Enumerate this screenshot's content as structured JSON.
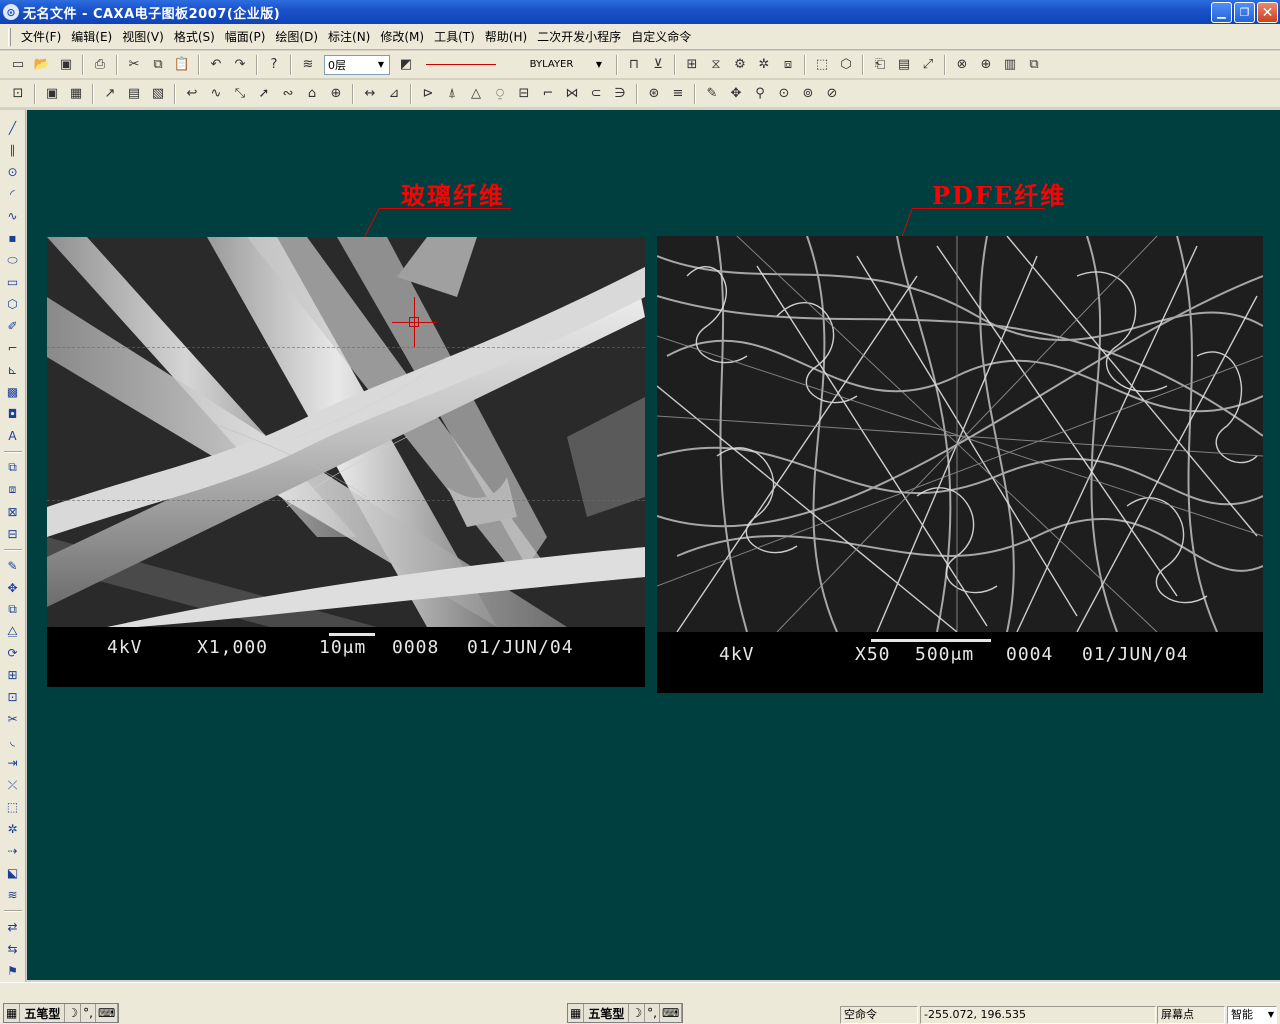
{
  "window": {
    "title": "无名文件 - CAXA电子图板2007(企业版)",
    "minimize_glyph": "▁",
    "restore_glyph": "❐",
    "close_glyph": "✕"
  },
  "menubar": {
    "items": [
      "文件(F)",
      "编辑(E)",
      "视图(V)",
      "格式(S)",
      "幅面(P)",
      "绘图(D)",
      "标注(N)",
      "修改(M)",
      "工具(T)",
      "帮助(H)",
      "二次开发小程序",
      "自定义命令"
    ]
  },
  "toolbar": {
    "layer_value": "0层",
    "linetype_value": "BYLAYER",
    "line_color": "#cc0000"
  },
  "drawing": {
    "background_color": "#003f3f",
    "caption_color": "#ff0000",
    "label_left": "玻璃纤维",
    "label_right": "PDFE纤维",
    "sem_left": {
      "voltage": "4kV",
      "magnification": "X1,000",
      "scale": "10μm",
      "number": "0008",
      "date": "01/JUN/04"
    },
    "sem_right": {
      "voltage": "4kV",
      "magnification": "X50",
      "scale": "500μm",
      "number": "0004",
      "date": "01/JUN/04"
    }
  },
  "statusbar": {
    "ime_left": {
      "name": "五笔型",
      "moon": "☽",
      "dot": "°,",
      "kbd": "⌨"
    },
    "ime_right": {
      "name": "五笔型",
      "moon": "☽",
      "dot": "°,",
      "kbd": "⌨"
    },
    "command": "空命令",
    "coordinates": "-255.072, 196.535",
    "snap_label": "屏幕点",
    "snap_mode": "智能"
  }
}
